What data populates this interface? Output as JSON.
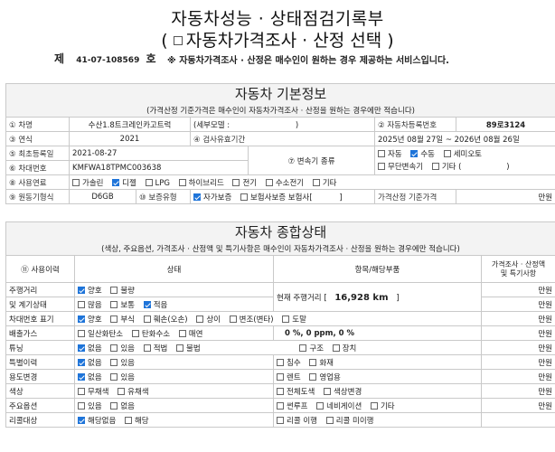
{
  "doc": {
    "title_line1": "자동차성능 · 상태점검기록부",
    "title_line2_open": "(",
    "title_line2_text": "자동차가격조사 · 산정 선택",
    "title_line2_close": ")",
    "je": "제",
    "number": "41-07-108569",
    "ho": "호",
    "note": "※ 자동차가격조사 · 산정은 매수인이 원하는 경우 제공하는 서비스입니다."
  },
  "basic": {
    "section_title": "자동차 기본정보",
    "section_sub": "(가격산정 기준가격은 매수인이 자동차가격조사 · 산정을 원하는 경우에만 적습니다)",
    "car_name_label": "① 차명",
    "car_name_value": "수산1.8트크레인카고트럭",
    "detail_model_label": "(세부모델 :",
    "detail_model_close": ")",
    "reg_no_label": "② 자동차등록번호",
    "reg_no_value": "89로3124",
    "year_label": "③ 연식",
    "year_value": "2021",
    "inspect_label": "④ 검사유효기간",
    "inspect_value": "2025년 08월 27일 ~ 2026년 08월 26일",
    "first_reg_label": "⑤ 최초등록일",
    "first_reg_value": "2021-08-27",
    "trans_label": "⑦ 변속기 종류",
    "trans_options": [
      {
        "label": "자동",
        "checked": false
      },
      {
        "label": "수동",
        "checked": true
      },
      {
        "label": "세미오토",
        "checked": false
      },
      {
        "label": "무단변속기",
        "checked": false
      },
      {
        "label": "기타 (",
        "checked": false
      }
    ],
    "trans_close": ")",
    "vin_label": "⑥ 차대번호",
    "vin_value": "KMFWA18TPMC003638",
    "fuel_label": "⑧ 사용연료",
    "fuel_options": [
      {
        "label": "가솔린",
        "checked": false
      },
      {
        "label": "디젤",
        "checked": true
      },
      {
        "label": "LPG",
        "checked": false
      },
      {
        "label": "하이브리드",
        "checked": false
      },
      {
        "label": "전기",
        "checked": false
      },
      {
        "label": "수소전기",
        "checked": false
      },
      {
        "label": "기타",
        "checked": false
      }
    ],
    "engine_label": "⑨ 원동기형식",
    "engine_value": "D6GB",
    "warranty_label": "⑩ 보증유형",
    "warranty_options": [
      {
        "label": "자가보증",
        "checked": true
      },
      {
        "label": "보험사보증 보험사[",
        "checked": false
      }
    ],
    "warranty_close": "]",
    "price_label": "가격산정 기준가격",
    "price_unit": "만원"
  },
  "overall": {
    "section_title": "자동차 종합상태",
    "section_sub": "(색상, 주요옵션, 가격조사 · 산정액 및 특기사항은 매수인이 자동차가격조사 · 산정을 원하는 경우에만 적습니다)",
    "col_history": "⑪ 사용이력",
    "col_state": "상태",
    "col_items": "항목/해당부품",
    "col_price_line1": "가격조사 · 산정액",
    "col_price_line2": "및 특기사항",
    "unit": "만원",
    "rows": [
      {
        "label": "주행거리",
        "options": [
          {
            "label": "양호",
            "checked": true
          },
          {
            "label": "불량",
            "checked": false
          }
        ]
      },
      {
        "label": "및 계기상태",
        "options": [
          {
            "label": "많음",
            "checked": false
          },
          {
            "label": "보통",
            "checked": false
          },
          {
            "label": "적음",
            "checked": true
          }
        ]
      },
      {
        "label": "차대번호 표기",
        "options": [
          {
            "label": "양호",
            "checked": true
          },
          {
            "label": "부식",
            "checked": false
          },
          {
            "label": "훼손(오손)",
            "checked": false
          },
          {
            "label": "상이",
            "checked": false
          },
          {
            "label": "변조(변타)",
            "checked": false
          },
          {
            "label": "도말",
            "checked": false
          }
        ]
      },
      {
        "label": "배출가스",
        "options": [
          {
            "label": "일산화탄소",
            "checked": false
          },
          {
            "label": "탄화수소",
            "checked": false
          },
          {
            "label": "매연",
            "checked": false
          }
        ]
      },
      {
        "label": "튜닝",
        "options": [
          {
            "label": "없음",
            "checked": true
          },
          {
            "label": "있음",
            "checked": false
          },
          {
            "label": "적법",
            "checked": false
          },
          {
            "label": "불법",
            "checked": false
          }
        ]
      },
      {
        "label": "특별이력",
        "options": [
          {
            "label": "없음",
            "checked": true
          },
          {
            "label": "있음",
            "checked": false
          }
        ]
      },
      {
        "label": "용도변경",
        "options": [
          {
            "label": "없음",
            "checked": true
          },
          {
            "label": "있음",
            "checked": false
          }
        ]
      },
      {
        "label": "색상",
        "options": [
          {
            "label": "무채색",
            "checked": false
          },
          {
            "label": "유채색",
            "checked": false
          }
        ]
      },
      {
        "label": "주요옵션",
        "options": [
          {
            "label": "있음",
            "checked": false
          },
          {
            "label": "없음",
            "checked": false
          }
        ]
      },
      {
        "label": "리콜대상",
        "options": [
          {
            "label": "해당없음",
            "checked": true
          },
          {
            "label": "해당",
            "checked": false
          }
        ]
      }
    ],
    "mileage_text": "현재 주행거리 [",
    "mileage_value": "16,928 km",
    "mileage_close": "]",
    "emission_values": "0 %,   0 ppm,   0 %",
    "tuning_items": [
      {
        "label": "구조",
        "checked": false
      },
      {
        "label": "장치",
        "checked": false
      }
    ],
    "special_items": [
      {
        "label": "침수",
        "checked": false
      },
      {
        "label": "화재",
        "checked": false
      }
    ],
    "usage_items": [
      {
        "label": "렌트",
        "checked": false
      },
      {
        "label": "영업용",
        "checked": false
      }
    ],
    "color_items": [
      {
        "label": "전체도색",
        "checked": false
      },
      {
        "label": "색상변경",
        "checked": false
      }
    ],
    "option_items": [
      {
        "label": "썬루프",
        "checked": false
      },
      {
        "label": "네비게이션",
        "checked": false
      },
      {
        "label": "기타",
        "checked": false
      }
    ],
    "recall_items": [
      {
        "label": "리콜 이행",
        "checked": false
      },
      {
        "label": "리콜 미이행",
        "checked": false
      }
    ]
  }
}
